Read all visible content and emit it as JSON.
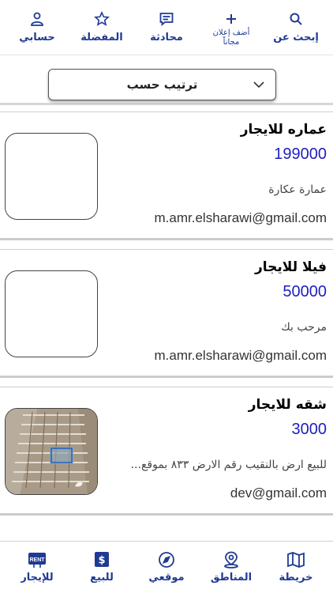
{
  "top_nav": {
    "account": {
      "label": "حسابي",
      "icon": "user-icon"
    },
    "favorites": {
      "label": "المفضلة",
      "icon": "star-icon"
    },
    "chat": {
      "label": "محادثة",
      "icon": "chat-icon"
    },
    "add_listing": {
      "label": "أضف إعلان مجاناً",
      "icon": "plus-icon"
    },
    "search": {
      "label": "إبحث عن",
      "icon": "search-icon"
    }
  },
  "sort": {
    "label": "ترتيب حسب"
  },
  "listings": [
    {
      "title": "عماره للايجار",
      "price": "199000",
      "description": "عمارة عكارة",
      "email": "m.amr.elsharawi@gmail.com",
      "has_image": false
    },
    {
      "title": "فيلا للايجار",
      "price": "50000",
      "description": "مرحب بك",
      "email": "m.amr.elsharawi@gmail.com",
      "has_image": false
    },
    {
      "title": "شقه للايجار",
      "price": "3000",
      "description": "للبيع ارض بالنقيب رقم الارض ٨٣٣ بموقع...",
      "email": "dev@gmail.com",
      "has_image": true
    }
  ],
  "bottom_nav": {
    "rent": {
      "label": "للإيجار",
      "icon": "rent-icon",
      "badge": "RENT"
    },
    "sale": {
      "label": "للبيع",
      "icon": "dollar-icon"
    },
    "location": {
      "label": "موقعي",
      "icon": "compass-icon"
    },
    "regions": {
      "label": "المناطق",
      "icon": "map-pin-icon"
    },
    "map": {
      "label": "خريطة",
      "icon": "map-icon"
    }
  },
  "colors": {
    "accent": "#1f3a93",
    "price": "#1e1ebf"
  }
}
